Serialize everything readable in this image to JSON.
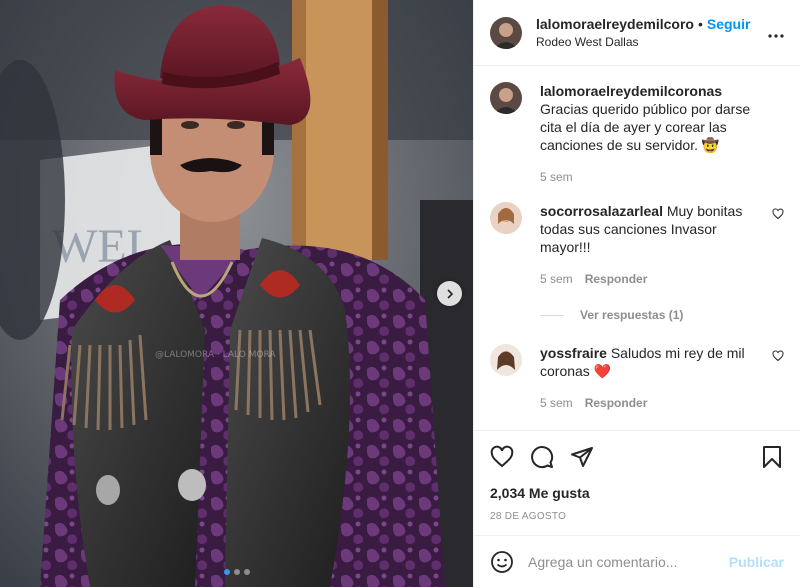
{
  "post": {
    "username": "lalomoraelreydemilcoro",
    "separator": "•",
    "follow_label": "Seguir",
    "location": "Rodeo West Dallas",
    "more_icon": "more-options-icon"
  },
  "photo": {
    "watermark": "@LALOMORA · LALO MORA",
    "sign_text": "WEL",
    "carousel_dots": 3,
    "active_dot": 0
  },
  "caption": {
    "username": "lalomoraelreydemilcoronas",
    "text": "Gracias querido público por darse cita el día de ayer y corear las canciones de su servidor. 🤠",
    "time": "5 sem"
  },
  "comments": [
    {
      "username": "socorrosalazarleal",
      "text": "Muy bonitas todas sus canciones Invasor mayor!!!",
      "time": "5 sem",
      "reply_label": "Responder",
      "view_replies": "Ver respuestas (1)"
    },
    {
      "username": "yossfraire",
      "text": "Saludos mi rey de mil coronas ❤️",
      "time": "5 sem",
      "reply_label": "Responder"
    }
  ],
  "actions": {
    "likes": "2,034 Me gusta",
    "date": "28 DE AGOSTO"
  },
  "add_comment": {
    "placeholder": "Agrega un comentario...",
    "publish_label": "Publicar"
  },
  "colors": {
    "accent": "#0095f6",
    "publish_disabled": "#b2dffc",
    "muted": "#8e8e8e",
    "hat": "#6e1f2c",
    "shirt": "#4a2452"
  }
}
